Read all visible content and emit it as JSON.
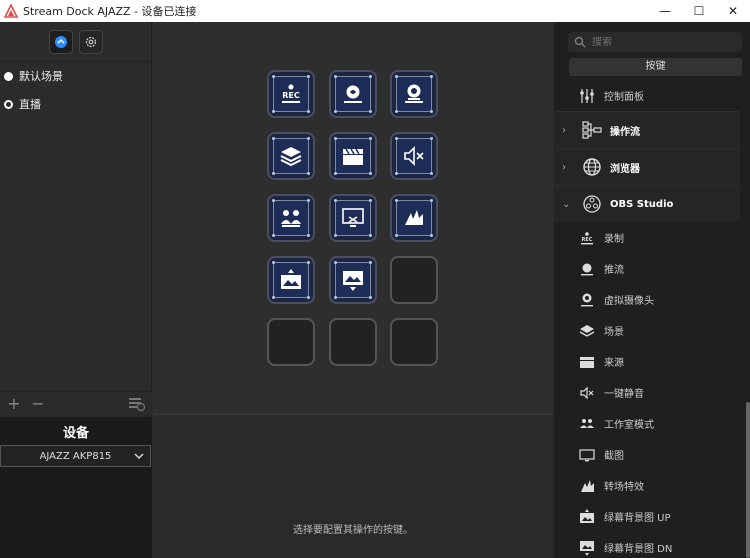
{
  "window": {
    "title": "Stream Dock AJAZZ - 设备已连接"
  },
  "left": {
    "profiles": [
      {
        "label": "默认场景"
      },
      {
        "label": "直播"
      }
    ],
    "device_title": "设备",
    "device_selected": "AJAZZ AKP815"
  },
  "middle": {
    "hint": "选择要配置其操作的按键。",
    "keys": [
      {
        "icon": "rec-icon"
      },
      {
        "icon": "stream-icon"
      },
      {
        "icon": "virtual-camera-icon"
      },
      {
        "icon": "scene-layers-icon"
      },
      {
        "icon": "clapper-icon"
      },
      {
        "icon": "mute-icon"
      },
      {
        "icon": "studio-mode-icon"
      },
      {
        "icon": "screenshot-icon"
      },
      {
        "icon": "transition-icon"
      },
      {
        "icon": "background-up-icon"
      },
      {
        "icon": "background-down-icon"
      },
      {
        "icon": ""
      },
      {
        "icon": ""
      },
      {
        "icon": ""
      },
      {
        "icon": ""
      }
    ]
  },
  "right": {
    "search_placeholder": "搜索",
    "keys_button": "按键",
    "top_item": "控制面板",
    "categories": [
      {
        "label": "操作流"
      },
      {
        "label": "浏览器"
      },
      {
        "label": "OBS Studio"
      }
    ],
    "obs_items": [
      {
        "label": "录制"
      },
      {
        "label": "推流"
      },
      {
        "label": "虚拟摄像头"
      },
      {
        "label": "场景"
      },
      {
        "label": "来源"
      },
      {
        "label": "一键静音"
      },
      {
        "label": "工作室模式"
      },
      {
        "label": "截图"
      },
      {
        "label": "转场特效"
      },
      {
        "label": "绿幕背景图 UP"
      },
      {
        "label": "绿幕背景图 DN"
      }
    ]
  }
}
